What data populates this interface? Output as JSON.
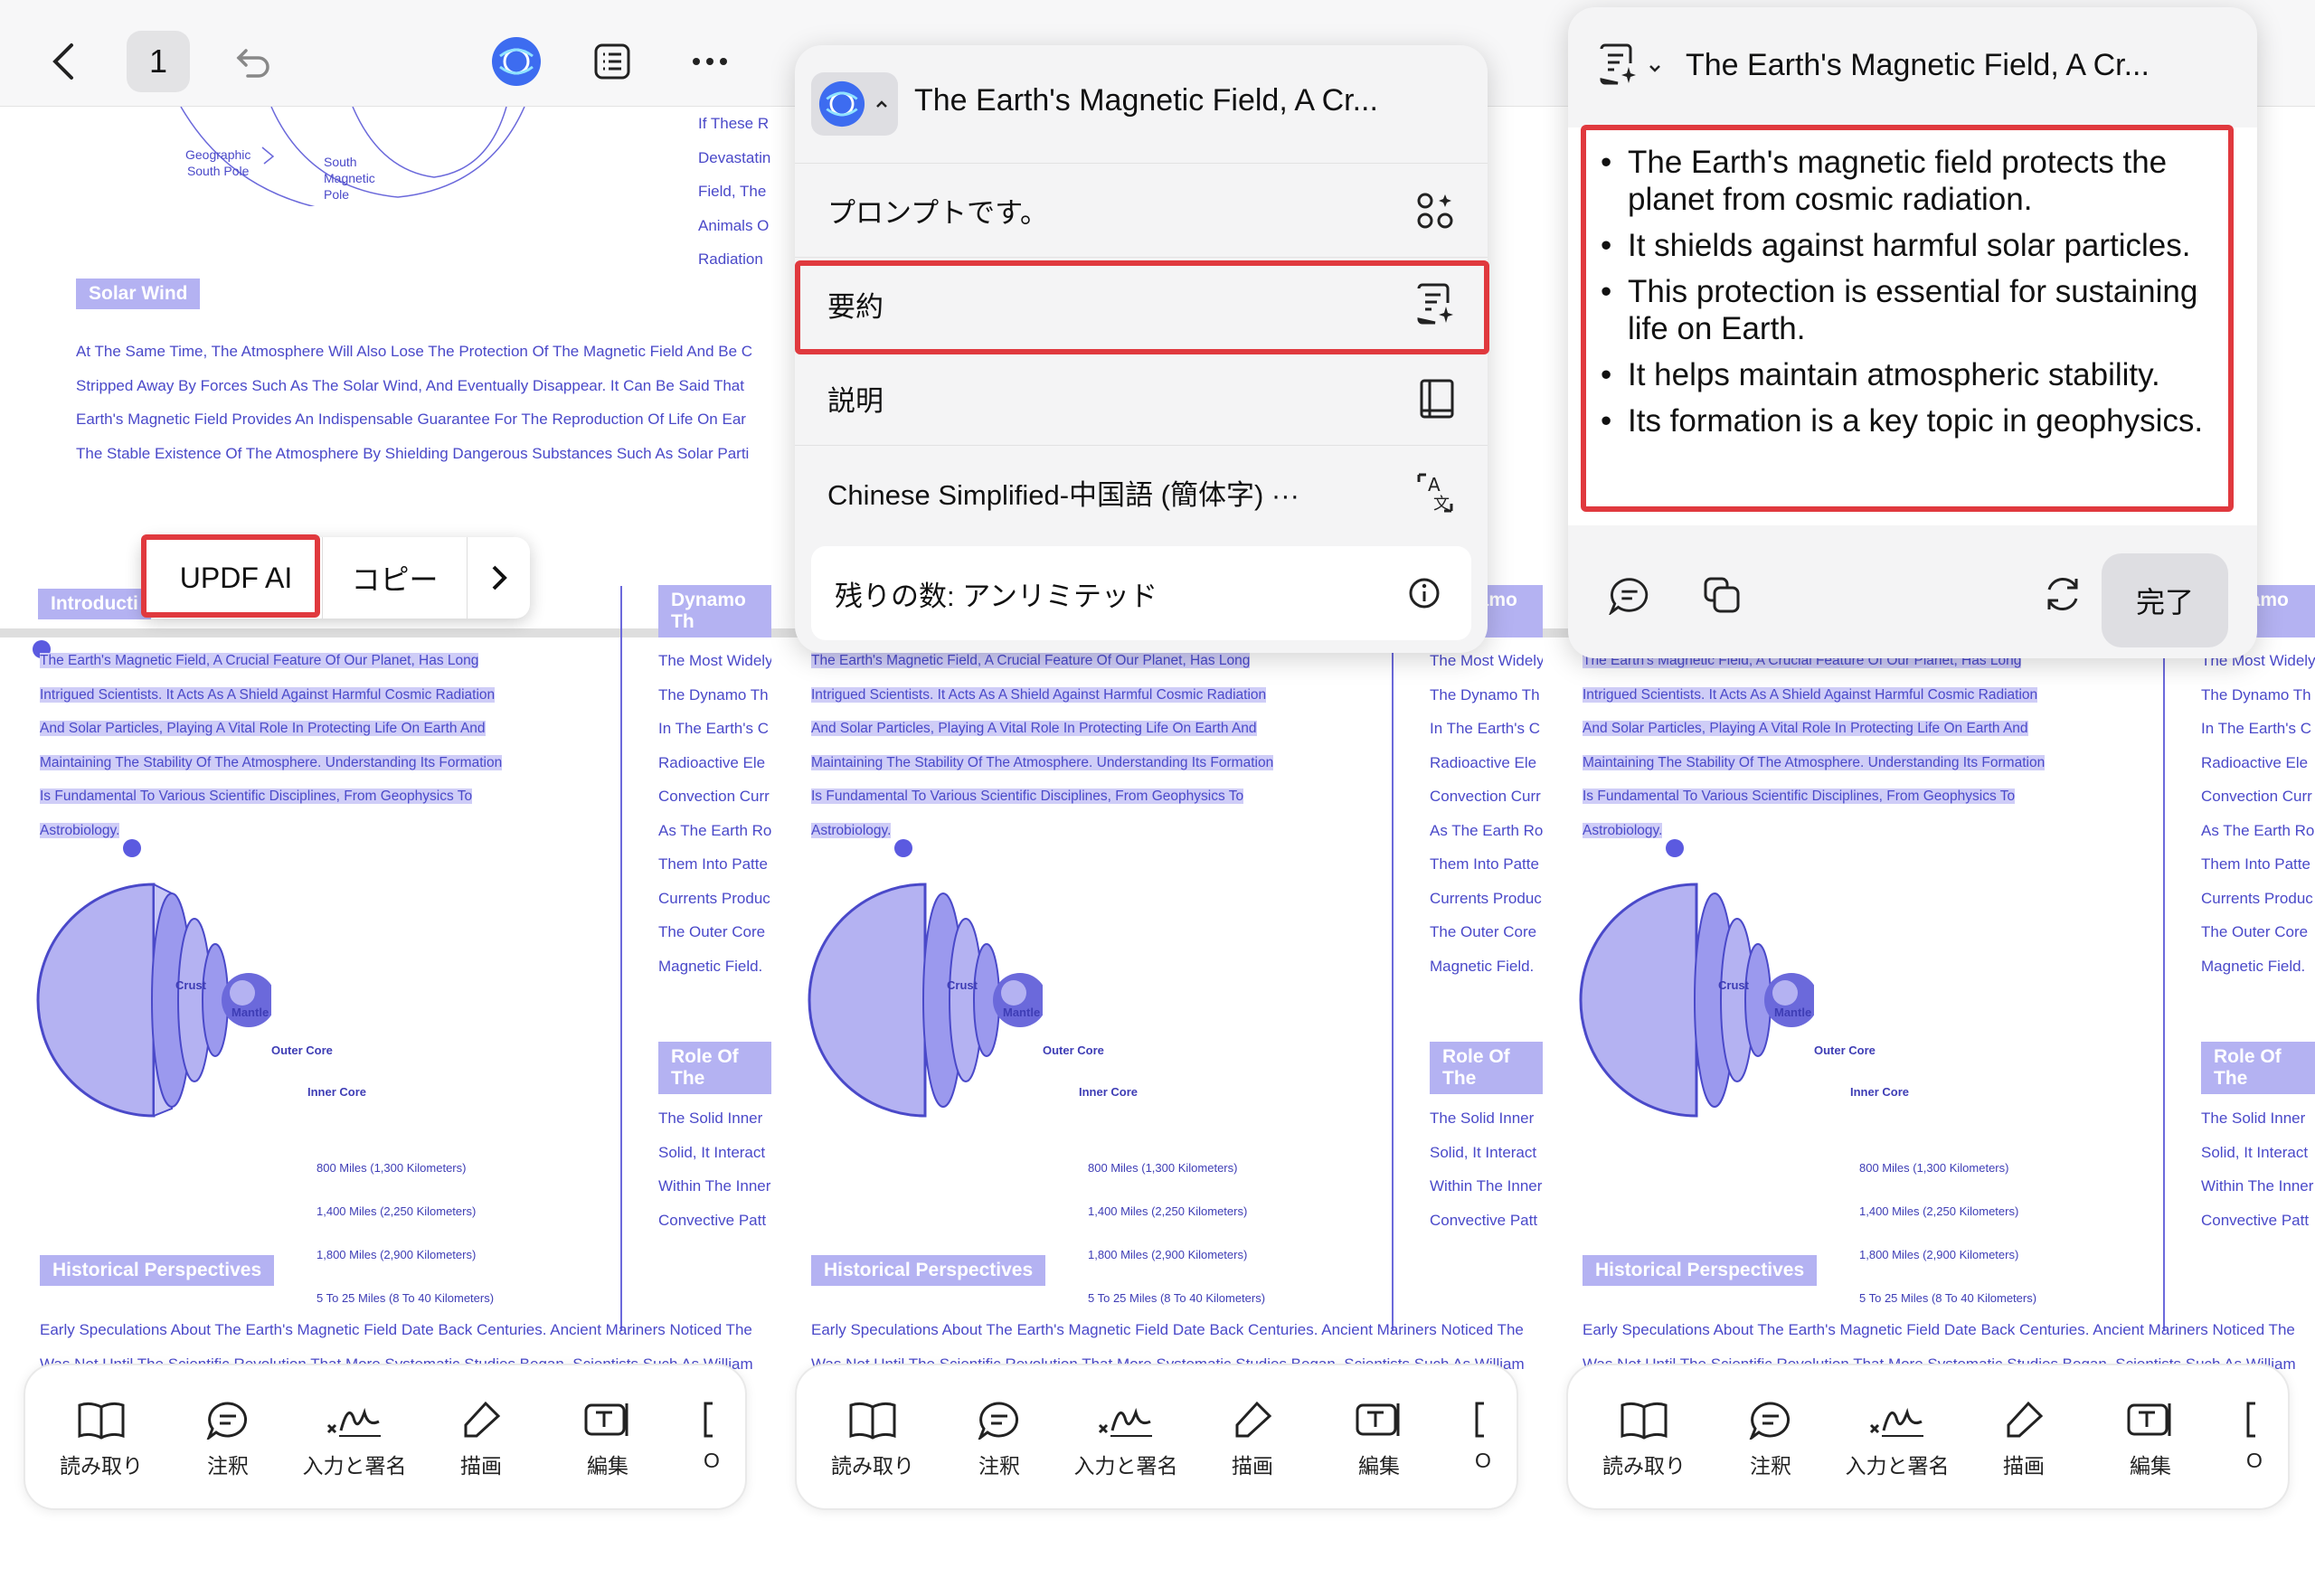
{
  "toolbar": {
    "page_number": "1"
  },
  "doc": {
    "geo_south_pole": "Geographic\nSouth Pole",
    "south_magnetic_pole": "South\nMagnetic\nPole",
    "right_top_lines": [
      "If These R",
      "Devastatin",
      "Field, The",
      "Animals O",
      "Radiation"
    ],
    "solar_wind_label": "Solar Wind",
    "solar_wind_lines": [
      "At The Same Time, The Atmosphere Will Also Lose The Protection Of The Magnetic Field And Be C",
      "Stripped Away By Forces Such As The Solar Wind, And Eventually Disappear. It Can Be Said That",
      "Earth's Magnetic Field Provides An Indispensable Guarantee For The Reproduction Of Life On Ear",
      "The Stable Existence Of The Atmosphere By Shielding Dangerous Substances Such As Solar Parti"
    ],
    "intro_label": "Introducti",
    "intro_lines": [
      "The Earth's Magnetic Field, A Crucial Feature Of Our Planet, Has Long",
      "Intrigued Scientists. It Acts As A Shield Against Harmful Cosmic Radiation",
      "And Solar Particles, Playing A Vital Role In Protecting Life On Earth And",
      "Maintaining The Stability Of The Atmosphere. Understanding Its Formation",
      "Is Fundamental To Various Scientific Disciplines, From Geophysics To",
      "Astrobiology."
    ],
    "dynamo_label": "Dynamo Th",
    "dynamo_lines": [
      "The Most Widely",
      "The Dynamo Th",
      "In The Earth's C",
      "Radioactive Ele",
      "Convection Curr",
      "As The Earth Ro",
      "Them Into Patte",
      "Currents Produc",
      "The Outer Core",
      "Magnetic Field."
    ],
    "role_label": "Role Of The",
    "role_lines": [
      "The Solid Inner",
      "Solid, It Interact",
      "Within The Inner",
      "Convective Patt"
    ],
    "layers": {
      "crust": "Crust",
      "mantle": "Mantle",
      "outer_core": "Outer Core",
      "inner_core": "Inner Core"
    },
    "distances": [
      "800 Miles (1,300 Kilometers)",
      "1,400 Miles (2,250 Kilometers)",
      "1,800 Miles (2,900 Kilometers)",
      "5 To 25 Miles (8 To 40 Kilometers)"
    ],
    "historical_label": "Historical Perspectives",
    "historical_lines": [
      "Early Speculations About The Earth's Magnetic Field Date Back Centuries. Ancient Mariners Noticed The",
      "Was Not Until The Scientific Revolution That More Systematic Studies Began. Scientists Such As William"
    ]
  },
  "context_menu": {
    "updf_ai": "UPDF AI",
    "copy": "コピー"
  },
  "ai_menu": {
    "title": "The Earth's Magnetic Field, A Cr...",
    "items": [
      {
        "label": "プロンプトです。",
        "icon": "prompt-grid-icon"
      },
      {
        "label": "要約",
        "icon": "summary-icon"
      },
      {
        "label": "説明",
        "icon": "book-icon"
      },
      {
        "label": "Chinese Simplified-中国語 (簡体字) ···",
        "icon": "translate-icon"
      }
    ],
    "remaining": "残りの数: アンリミテッド"
  },
  "summary_panel": {
    "title": "The Earth's Magnetic Field, A Cr...",
    "bullets": [
      "The Earth's magnetic field protects the planet from cosmic radiation.",
      "It shields against harmful solar particles.",
      "This protection is essential for sustaining life on Earth.",
      "It helps maintain atmospheric stability.",
      "Its formation is a key topic in geophysics."
    ],
    "done": "完了"
  },
  "bottom_tools": [
    "読み取り",
    "注釈",
    "入力と署名",
    "描画",
    "編集",
    "O"
  ],
  "colors": {
    "accent": "#6b69db",
    "highlight": "#cfcdf7",
    "label_bg": "#b4b2f2",
    "red_outline": "#e0393e"
  }
}
